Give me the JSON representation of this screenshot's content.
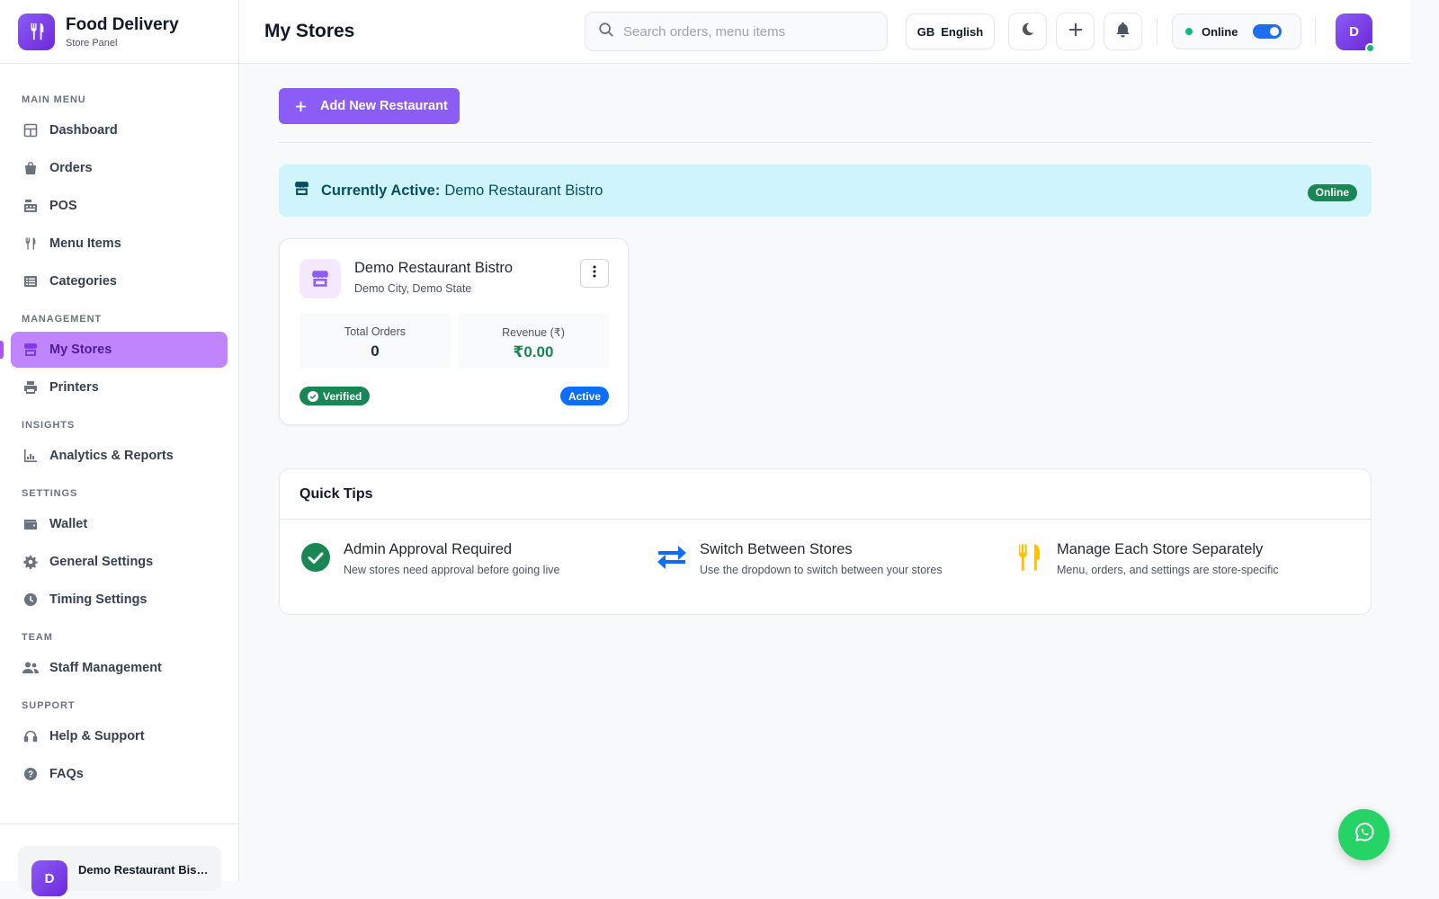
{
  "brand": {
    "title": "Food Delivery",
    "subtitle": "Store Panel"
  },
  "header": {
    "page_title": "My Stores",
    "search_placeholder": "Search orders, menu items",
    "language": {
      "code": "GB",
      "label": "English"
    },
    "status_label": "Online",
    "status_on": true,
    "avatar_initial": "D"
  },
  "sidebar": {
    "sections": [
      {
        "title": "MAIN MENU",
        "items": [
          {
            "label": "Dashboard",
            "icon": "dashboard-icon"
          },
          {
            "label": "Orders",
            "icon": "shopping-bag-icon"
          },
          {
            "label": "POS",
            "icon": "cash-register-icon"
          },
          {
            "label": "Menu Items",
            "icon": "utensils-icon"
          },
          {
            "label": "Categories",
            "icon": "list-icon"
          }
        ]
      },
      {
        "title": "MANAGEMENT",
        "items": [
          {
            "label": "My Stores",
            "icon": "store-icon",
            "active": true
          },
          {
            "label": "Printers",
            "icon": "printer-icon"
          }
        ]
      },
      {
        "title": "INSIGHTS",
        "items": [
          {
            "label": "Analytics & Reports",
            "icon": "chart-icon"
          }
        ]
      },
      {
        "title": "SETTINGS",
        "items": [
          {
            "label": "Wallet",
            "icon": "wallet-icon"
          },
          {
            "label": "General Settings",
            "icon": "gear-icon"
          },
          {
            "label": "Timing Settings",
            "icon": "clock-icon"
          }
        ]
      },
      {
        "title": "TEAM",
        "items": [
          {
            "label": "Staff Management",
            "icon": "users-icon"
          }
        ]
      },
      {
        "title": "SUPPORT",
        "items": [
          {
            "label": "Help & Support",
            "icon": "headset-icon"
          },
          {
            "label": "FAQs",
            "icon": "question-icon"
          }
        ]
      }
    ],
    "footer": {
      "avatar_initial": "D",
      "store_name": "Demo Restaurant Bistro"
    }
  },
  "main": {
    "add_button_label": "Add New Restaurant",
    "active_banner": {
      "label": "Currently Active:",
      "value": "Demo Restaurant Bistro",
      "badge": "Online"
    },
    "store_card": {
      "name": "Demo Restaurant Bistro",
      "location": "Demo City, Demo State",
      "stats": [
        {
          "label": "Total Orders",
          "value": "0"
        },
        {
          "label": "Revenue (₹)",
          "value": "₹0.00"
        }
      ],
      "verified_label": "Verified",
      "active_label": "Active"
    },
    "tips": {
      "title": "Quick Tips",
      "items": [
        {
          "title": "Admin Approval Required",
          "desc": "New stores need approval before going live",
          "icon": "check-circle-icon"
        },
        {
          "title": "Switch Between Stores",
          "desc": "Use the dropdown to switch between your stores",
          "icon": "arrows-exchange-icon"
        },
        {
          "title": "Manage Each Store Separately",
          "desc": "Menu, orders, and settings are store-specific",
          "icon": "utensils-icon"
        }
      ]
    }
  },
  "colors": {
    "accent": "#8b5cf6",
    "active_nav": "#c084fc",
    "success": "#198754",
    "info_bg": "#cff4fc",
    "primary_blue": "#0d6efd",
    "whatsapp": "#25d366"
  }
}
